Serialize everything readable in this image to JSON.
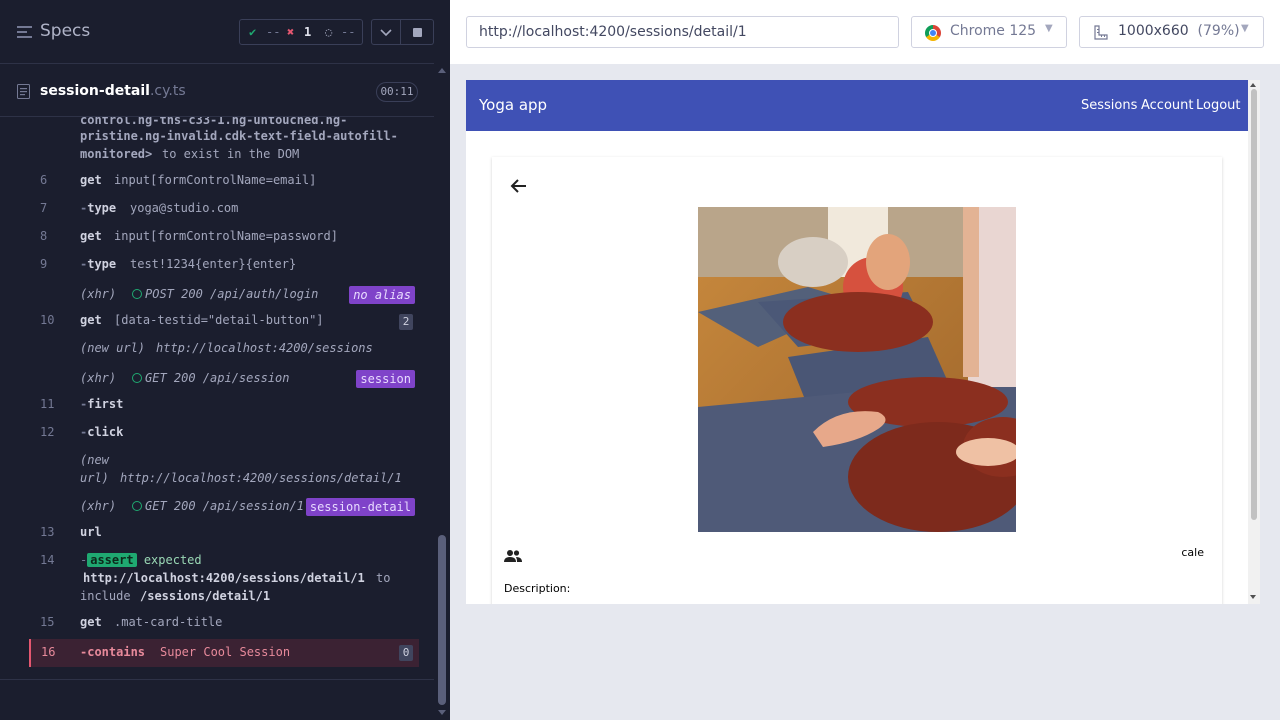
{
  "reporter": {
    "specs_title": "Specs",
    "stats": {
      "passed": "--",
      "failed": "1",
      "pending": "--"
    },
    "file": {
      "name": "session-detail",
      "ext": ".cy.ts",
      "duration": "00:11"
    },
    "log": {
      "overflow_text": [
        "control.ng-tns-c33-1.ng-untouched.ng-",
        "pristine.ng-invalid.cdk-text-field-autofill-",
        "monitored>"
      ],
      "overflow_tail": "to exist in the DOM",
      "cmd6": {
        "num": "6",
        "name": "get",
        "msg": "input[formControlName=email]"
      },
      "cmd7": {
        "num": "7",
        "name": "type",
        "msg": "yoga@studio.com"
      },
      "cmd8": {
        "num": "8",
        "name": "get",
        "msg": "input[formControlName=password]"
      },
      "cmd9": {
        "num": "9",
        "name": "type",
        "msg": "test!1234{enter}{enter}"
      },
      "xhr1": {
        "label": "(xhr)",
        "msg": "POST 200 /api/auth/login",
        "alias": "no alias"
      },
      "cmd10": {
        "num": "10",
        "name": "get",
        "msg": "[data-testid=\"detail-button\"]",
        "count": "2"
      },
      "newurl1": {
        "label": "(new url)",
        "msg": "http://localhost:4200/sessions"
      },
      "xhr2": {
        "label": "(xhr)",
        "msg": "GET 200 /api/session",
        "alias": "session"
      },
      "cmd11": {
        "num": "11",
        "name": "first"
      },
      "cmd12": {
        "num": "12",
        "name": "click"
      },
      "newurl2": {
        "label_a": "(new",
        "label_b": "url)",
        "msg": "http://localhost:4200/sessions/detail/1"
      },
      "xhr3": {
        "label": "(xhr)",
        "msg": "GET 200 /api/session/1",
        "alias": "session-detail"
      },
      "cmd13": {
        "num": "13",
        "name": "url"
      },
      "cmd14": {
        "num": "14",
        "badge": "assert",
        "expected": "expected",
        "url": "http://localhost:4200/sessions/detail/1",
        "to": "to",
        "include": "include",
        "path": "/sessions/detail/1"
      },
      "cmd15": {
        "num": "15",
        "name": "get",
        "msg": ".mat-card-title"
      },
      "cmd16": {
        "num": "16",
        "name": "contains",
        "msg": "Super Cool Session",
        "count": "0"
      }
    }
  },
  "topbar": {
    "url": "http://localhost:4200/sessions/detail/1",
    "browser": "Chrome 125",
    "viewport": "1000x660",
    "viewport_scale": "(79%)"
  },
  "app": {
    "title": "Yoga app",
    "nav": [
      "Sessions",
      "Account",
      "Logout"
    ],
    "card_right_text": "cale",
    "description_label": "Description:"
  },
  "colors": {
    "reporter_bg": "#1b1e2e",
    "fail": "#e45770",
    "pass": "#1fa971",
    "alias_purple": "#7f43c9",
    "app_primary": "#3f51b5"
  },
  "icons": [
    "menu-icon",
    "check-icon",
    "x-icon",
    "spinner-icon",
    "chevron-down-icon",
    "stop-icon",
    "document-icon",
    "chrome-icon",
    "ruler-icon",
    "arrow-back-icon",
    "group-icon"
  ]
}
